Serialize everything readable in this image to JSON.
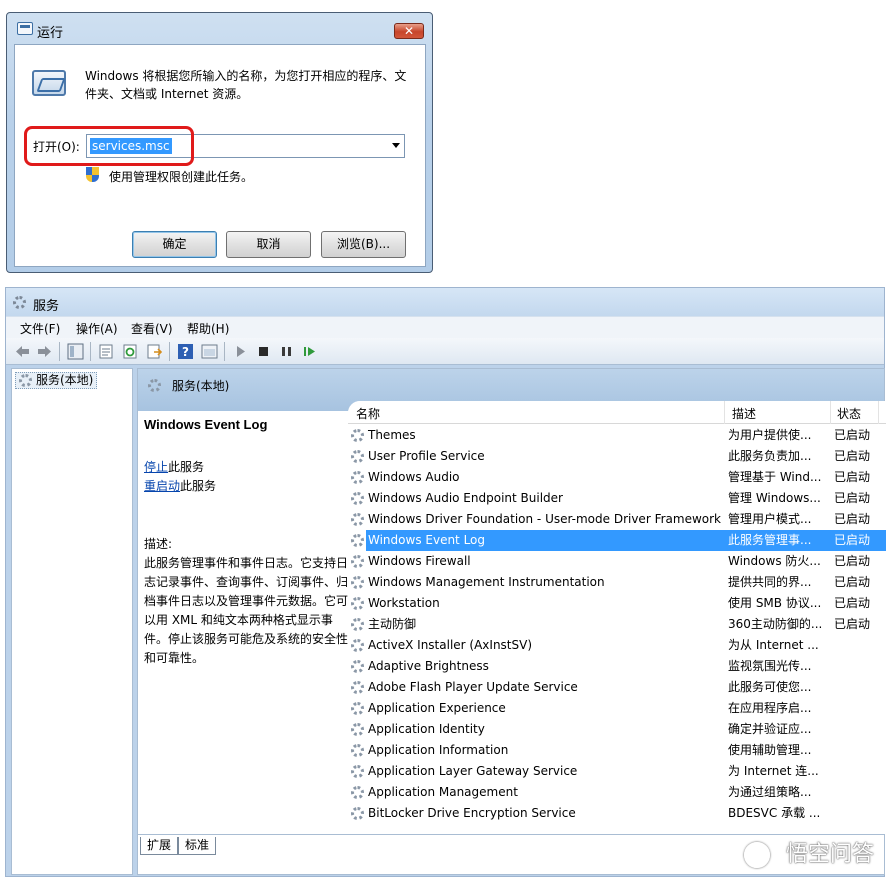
{
  "run_dialog": {
    "title": "运行",
    "close_label": "✕",
    "description": "Windows 将根据您所输入的名称，为您打开相应的程序、文件夹、文档或 Internet 资源。",
    "open_label": "打开(O):",
    "open_value": "services.msc",
    "admin_text": "使用管理权限创建此任务。",
    "buttons": {
      "ok": "确定",
      "cancel": "取消",
      "browse": "浏览(B)..."
    },
    "highlight_color": "#e01a1a"
  },
  "services_window": {
    "title": "服务",
    "menu": [
      "文件(F)",
      "操作(A)",
      "查看(V)",
      "帮助(H)"
    ],
    "tree_item": "服务(本地)",
    "header_title": "服务(本地)",
    "detail": {
      "service_title": "Windows Event Log",
      "stop_link": "停止",
      "stop_suffix": "此服务",
      "restart_link": "重启动",
      "restart_suffix": "此服务",
      "desc_label": "描述:",
      "desc_text": "此服务管理事件和事件日志。它支持日志记录事件、查询事件、订阅事件、归档事件日志以及管理事件元数据。它可以用 XML 和纯文本两种格式显示事件。停止该服务可能危及系统的安全性和可靠性。"
    },
    "columns": {
      "name": "名称",
      "desc": "描述",
      "status": "状态"
    },
    "rows": [
      {
        "name": "Themes",
        "desc": "为用户提供使...",
        "status": "已启动"
      },
      {
        "name": "User Profile Service",
        "desc": "此服务负责加...",
        "status": "已启动"
      },
      {
        "name": "Windows Audio",
        "desc": "管理基于 Wind...",
        "status": "已启动"
      },
      {
        "name": "Windows Audio Endpoint Builder",
        "desc": "管理 Windows...",
        "status": "已启动"
      },
      {
        "name": "Windows Driver Foundation - User-mode Driver Framework",
        "desc": "管理用户模式...",
        "status": "已启动"
      },
      {
        "name": "Windows Event Log",
        "desc": "此服务管理事...",
        "status": "已启动",
        "selected": true
      },
      {
        "name": "Windows Firewall",
        "desc": "Windows 防火...",
        "status": "已启动"
      },
      {
        "name": "Windows Management Instrumentation",
        "desc": "提供共同的界...",
        "status": "已启动"
      },
      {
        "name": "Workstation",
        "desc": "使用 SMB 协议...",
        "status": "已启动"
      },
      {
        "name": "主动防御",
        "desc": "360主动防御的...",
        "status": "已启动"
      },
      {
        "name": "ActiveX Installer (AxInstSV)",
        "desc": "为从 Internet ...",
        "status": ""
      },
      {
        "name": "Adaptive Brightness",
        "desc": "监视氛围光传...",
        "status": ""
      },
      {
        "name": "Adobe Flash Player Update Service",
        "desc": "此服务可使您...",
        "status": ""
      },
      {
        "name": "Application Experience",
        "desc": "在应用程序启...",
        "status": ""
      },
      {
        "name": "Application Identity",
        "desc": "确定并验证应...",
        "status": ""
      },
      {
        "name": "Application Information",
        "desc": "使用辅助管理...",
        "status": ""
      },
      {
        "name": "Application Layer Gateway Service",
        "desc": "为 Internet 连...",
        "status": ""
      },
      {
        "name": "Application Management",
        "desc": "为通过组策略...",
        "status": ""
      },
      {
        "name": "BitLocker Drive Encryption Service",
        "desc": "BDESVC 承载 ...",
        "status": ""
      }
    ],
    "tabs": [
      "扩展",
      "标准"
    ]
  },
  "watermark": "悟空问答",
  "icons": {
    "run_title": "run-icon",
    "toolbar": [
      "back-icon",
      "forward-icon",
      "console-tree-icon",
      "properties-icon",
      "refresh-icon",
      "export-icon",
      "help-icon",
      "view-icon",
      "start-icon",
      "stop-icon",
      "pause-icon",
      "restart-icon"
    ]
  }
}
